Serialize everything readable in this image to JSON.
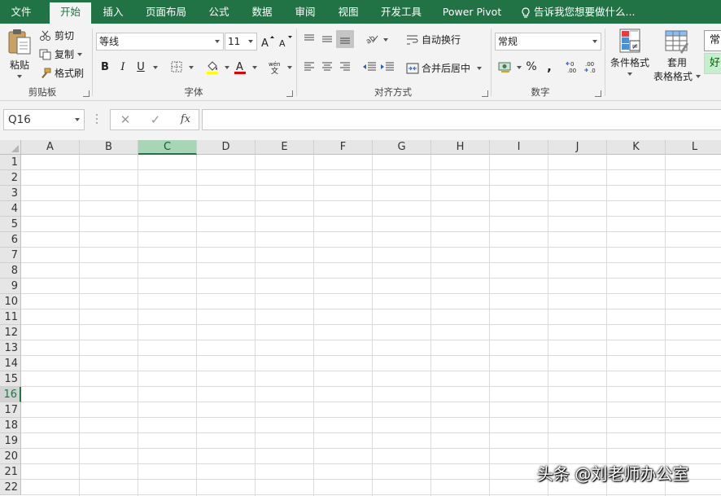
{
  "tabs": [
    {
      "label": "文件"
    },
    {
      "label": "开始",
      "active": true
    },
    {
      "label": "插入"
    },
    {
      "label": "页面布局"
    },
    {
      "label": "公式"
    },
    {
      "label": "数据"
    },
    {
      "label": "审阅"
    },
    {
      "label": "视图"
    },
    {
      "label": "开发工具"
    },
    {
      "label": "Power Pivot"
    }
  ],
  "tell_me": "告诉我您想要做什么...",
  "ribbon": {
    "clipboard": {
      "paste": "粘贴",
      "cut": "剪切",
      "copy": "复制",
      "format_painter": "格式刷",
      "group_label": "剪贴板"
    },
    "font": {
      "font_name": "等线",
      "font_size": "11",
      "bold": "B",
      "italic": "I",
      "underline": "U",
      "group_label": "字体"
    },
    "alignment": {
      "wrap_text": "自动换行",
      "merge_center": "合并后居中",
      "group_label": "对齐方式"
    },
    "number": {
      "format": "常规",
      "percent": "%",
      "comma": ",",
      "group_label": "数字"
    },
    "styles": {
      "conditional_format": "条件格式",
      "table_format_line1": "套用",
      "table_format_line2": "表格格式",
      "style_normal": "常",
      "style_good": "好"
    }
  },
  "formula_bar": {
    "name_box": "Q16",
    "cancel": "✕",
    "enter": "✓",
    "fx": "fx",
    "formula": ""
  },
  "grid": {
    "columns": [
      "A",
      "B",
      "C",
      "D",
      "E",
      "F",
      "G",
      "H",
      "I",
      "J",
      "K",
      "L"
    ],
    "rows": [
      "1",
      "2",
      "3",
      "4",
      "5",
      "6",
      "7",
      "8",
      "9",
      "10",
      "11",
      "12",
      "13",
      "14",
      "15",
      "16",
      "17",
      "18",
      "19",
      "20",
      "21",
      "22"
    ],
    "selected_column": "C",
    "selected_row": "16"
  },
  "watermark": "头条 @刘老师办公室",
  "colors": {
    "accent": "#217346",
    "ribbon_bg": "#f3f3f3",
    "selected_header": "#a7d5b5"
  }
}
